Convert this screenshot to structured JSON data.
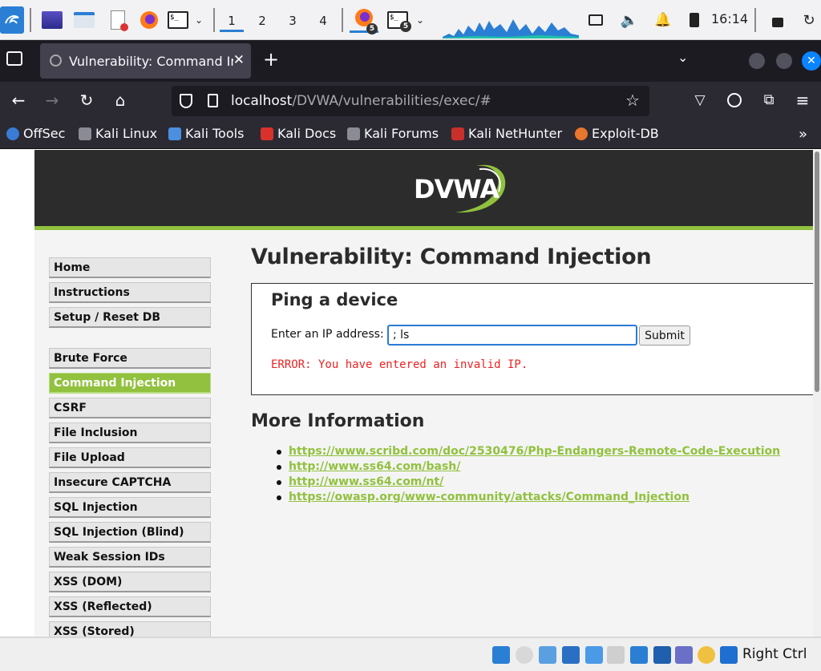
{
  "taskbar": {
    "workspaces": [
      "1",
      "2",
      "3",
      "4"
    ],
    "active_workspace": "1",
    "window_badges": [
      "5",
      "5"
    ],
    "clock": "16:14"
  },
  "browser": {
    "tab_title": "Vulnerability: Command Injection",
    "url_host": "localhost",
    "url_path": "/DVWA/vulnerabilities/exec/#",
    "bookmarks": [
      "OffSec",
      "Kali Linux",
      "Kali Tools",
      "Kali Docs",
      "Kali Forums",
      "Kali NetHunter",
      "Exploit-DB"
    ]
  },
  "dvwa": {
    "logo_text": "DVWA",
    "accent_color": "#91c13e",
    "menu_top": [
      "Home",
      "Instructions",
      "Setup / Reset DB"
    ],
    "menu_vulns": [
      "Brute Force",
      "Command Injection",
      "CSRF",
      "File Inclusion",
      "File Upload",
      "Insecure CAPTCHA",
      "SQL Injection",
      "SQL Injection (Blind)",
      "Weak Session IDs",
      "XSS (DOM)",
      "XSS (Reflected)",
      "XSS (Stored)"
    ],
    "selected_item": "Command Injection",
    "page_title": "Vulnerability: Command Injection",
    "box_title": "Ping a device",
    "ip_label": "Enter an IP address:",
    "ip_value": "; ls",
    "submit_label": "Submit",
    "error": "ERROR: You have entered an invalid IP.",
    "more_title": "More Information",
    "links": [
      "https://www.scribd.com/doc/2530476/Php-Endangers-Remote-Code-Execution",
      "http://www.ss64.com/bash/",
      "http://www.ss64.com/nt/",
      "https://owasp.org/www-community/attacks/Command_Injection"
    ]
  },
  "vbox": {
    "host_key": "Right Ctrl"
  }
}
